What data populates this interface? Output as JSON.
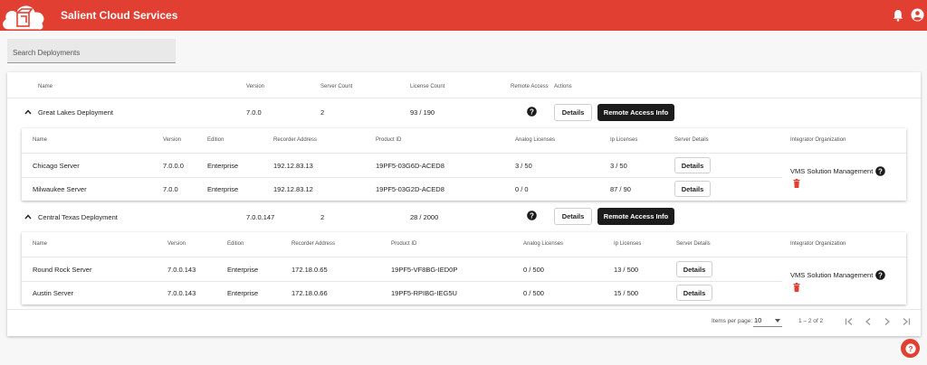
{
  "header": {
    "app_title": "Salient Cloud Services",
    "brand_color": "#e23f33",
    "icons": [
      "cloud-logo-icon",
      "bell-icon",
      "account-icon"
    ]
  },
  "search": {
    "placeholder": "Search Deployments",
    "value": ""
  },
  "deployments_table": {
    "columns": [
      "Name",
      "Version",
      "Server Count",
      "License Count",
      "Remote Access",
      "Actions"
    ],
    "rows": [
      {
        "name": "Great Lakes Deployment",
        "version": "7.0.0",
        "server_count": "2",
        "license_count": "93 / 190",
        "details_label": "Details",
        "remote_label": "Remote Access Info"
      },
      {
        "name": "Central Texas Deployment",
        "version": "7.0.0.147",
        "server_count": "2",
        "license_count": "28 / 2000",
        "details_label": "Details",
        "remote_label": "Remote Access Info"
      }
    ]
  },
  "server_tables": {
    "columns": [
      "Name",
      "Version",
      "Edition",
      "Recorder Address",
      "Product ID",
      "Analog Licenses",
      "Ip Licenses",
      "Server Details",
      "Integrator Organization"
    ],
    "groups": [
      {
        "integrator": "VMS Solution Management",
        "servers": [
          {
            "name": "Chicago Server",
            "version": "7.0.0.0",
            "edition": "Enterprise",
            "address": "192.12.83.13",
            "product_id": "19PF5-03G6D-ACED8",
            "analog": "3 / 50",
            "ip": "3 / 50",
            "details_label": "Details"
          },
          {
            "name": "Milwaukee Server",
            "version": "7.0.0",
            "edition": "Enterprise",
            "address": "192.12.83.12",
            "product_id": "19PF5-03G2D-ACED8",
            "analog": "0 / 0",
            "ip": "87 / 90",
            "details_label": "Details"
          }
        ]
      },
      {
        "integrator": "VMS Solution Management",
        "servers": [
          {
            "name": "Round Rock Server",
            "version": "7.0.0.143",
            "edition": "Enterprise",
            "address": "172.18.0.65",
            "product_id": "19PF5-VF8BG-IED0P",
            "analog": "0 / 500",
            "ip": "13 / 500",
            "details_label": "Details"
          },
          {
            "name": "Austin Server",
            "version": "7.0.0.143",
            "edition": "Enterprise",
            "address": "172.18.0.66",
            "product_id": "19PF5-RPIBG-IEG5U",
            "analog": "0 / 500",
            "ip": "15 / 500",
            "details_label": "Details"
          }
        ]
      }
    ]
  },
  "paginator": {
    "items_per_page_label": "Items per page:",
    "page_size": "10",
    "range_label": "1 – 2 of 2"
  }
}
